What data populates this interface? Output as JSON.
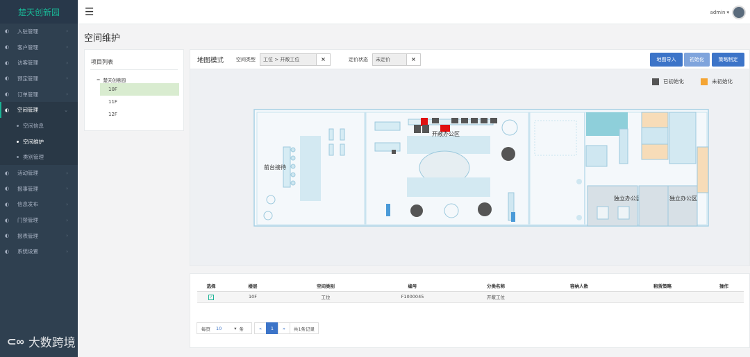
{
  "app": {
    "logo": "楚天创新园"
  },
  "sidebar": {
    "items": [
      {
        "label": "入驻管理",
        "icon": "gear-icon"
      },
      {
        "label": "客户管理",
        "icon": "gear-icon"
      },
      {
        "label": "访客管理",
        "icon": "gear-icon"
      },
      {
        "label": "预定管理",
        "icon": "gear-icon"
      },
      {
        "label": "订单管理",
        "icon": "gear-icon"
      },
      {
        "label": "空间管理",
        "icon": "gear-icon",
        "expanded": true
      },
      {
        "label": "活动管理",
        "icon": "gear-icon"
      },
      {
        "label": "报事管理",
        "icon": "gear-icon"
      },
      {
        "label": "信息发布",
        "icon": "gear-icon"
      },
      {
        "label": "门禁管理",
        "icon": "gear-icon"
      },
      {
        "label": "报表管理",
        "icon": "gear-icon"
      },
      {
        "label": "系统设置",
        "icon": "gear-icon"
      }
    ],
    "subitems": [
      {
        "label": "空间信息"
      },
      {
        "label": "空间维护",
        "active": true
      },
      {
        "label": "类别管理"
      }
    ]
  },
  "topbar": {
    "user": "admin"
  },
  "page": {
    "title": "空间维护"
  },
  "project": {
    "header": "项目列表",
    "root": "楚天创意园",
    "floors": [
      "10F",
      "11F",
      "12F"
    ],
    "selected_floor": "10F"
  },
  "map": {
    "title": "地图模式",
    "filter_type_label": "空间类型",
    "filter_type_value": "工位 > 开敞工位",
    "filter_price_label": "定价状态",
    "filter_price_value": "未定价",
    "btn_import": "地图导入",
    "btn_init": "初始化",
    "btn_strategy": "策略制定",
    "legend_inited": "已初始化",
    "legend_uninited": "未初始化",
    "color_inited": "#555555",
    "color_uninited": "#f4a534",
    "areas": {
      "reception": "前台接待",
      "open_office": "开敞办公区",
      "private_office_1": "独立办公区",
      "private_office_2": "独立办公区"
    }
  },
  "table": {
    "headers": [
      "选择",
      "楼层",
      "空间类别",
      "编号",
      "分类名称",
      "容纳人数",
      "租赁策略",
      "操作"
    ],
    "rows": [
      {
        "checked": true,
        "floor": "10F",
        "category": "工位",
        "code": "F1000045",
        "type_name": "开敞工位",
        "capacity": "",
        "strategy": "",
        "action": ""
      }
    ]
  },
  "pager": {
    "per_page_label": "每页",
    "per_page_value": "10",
    "per_page_unit": "条",
    "prev": "«",
    "current": "1",
    "next": "»",
    "total": "共1条记录"
  }
}
